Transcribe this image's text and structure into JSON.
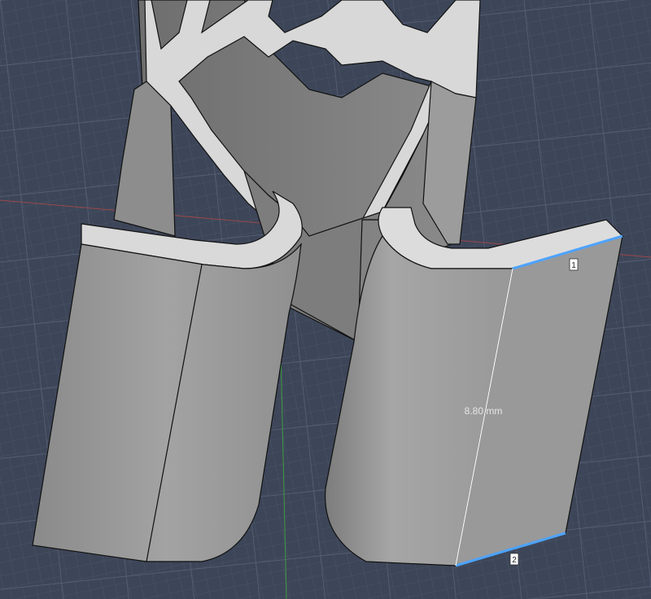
{
  "viewport": {
    "background_color": "#3d4658",
    "grid_color": "#56607a",
    "model_color": "#9a9a9a",
    "edge_color": "#111111",
    "selection_color": "#4da3ff",
    "x_axis_color": "#b04848",
    "y_axis_color": "#3fa63f"
  },
  "measurement": {
    "value_label": "8.80 mm",
    "edge_markers": [
      "1",
      "2"
    ]
  }
}
